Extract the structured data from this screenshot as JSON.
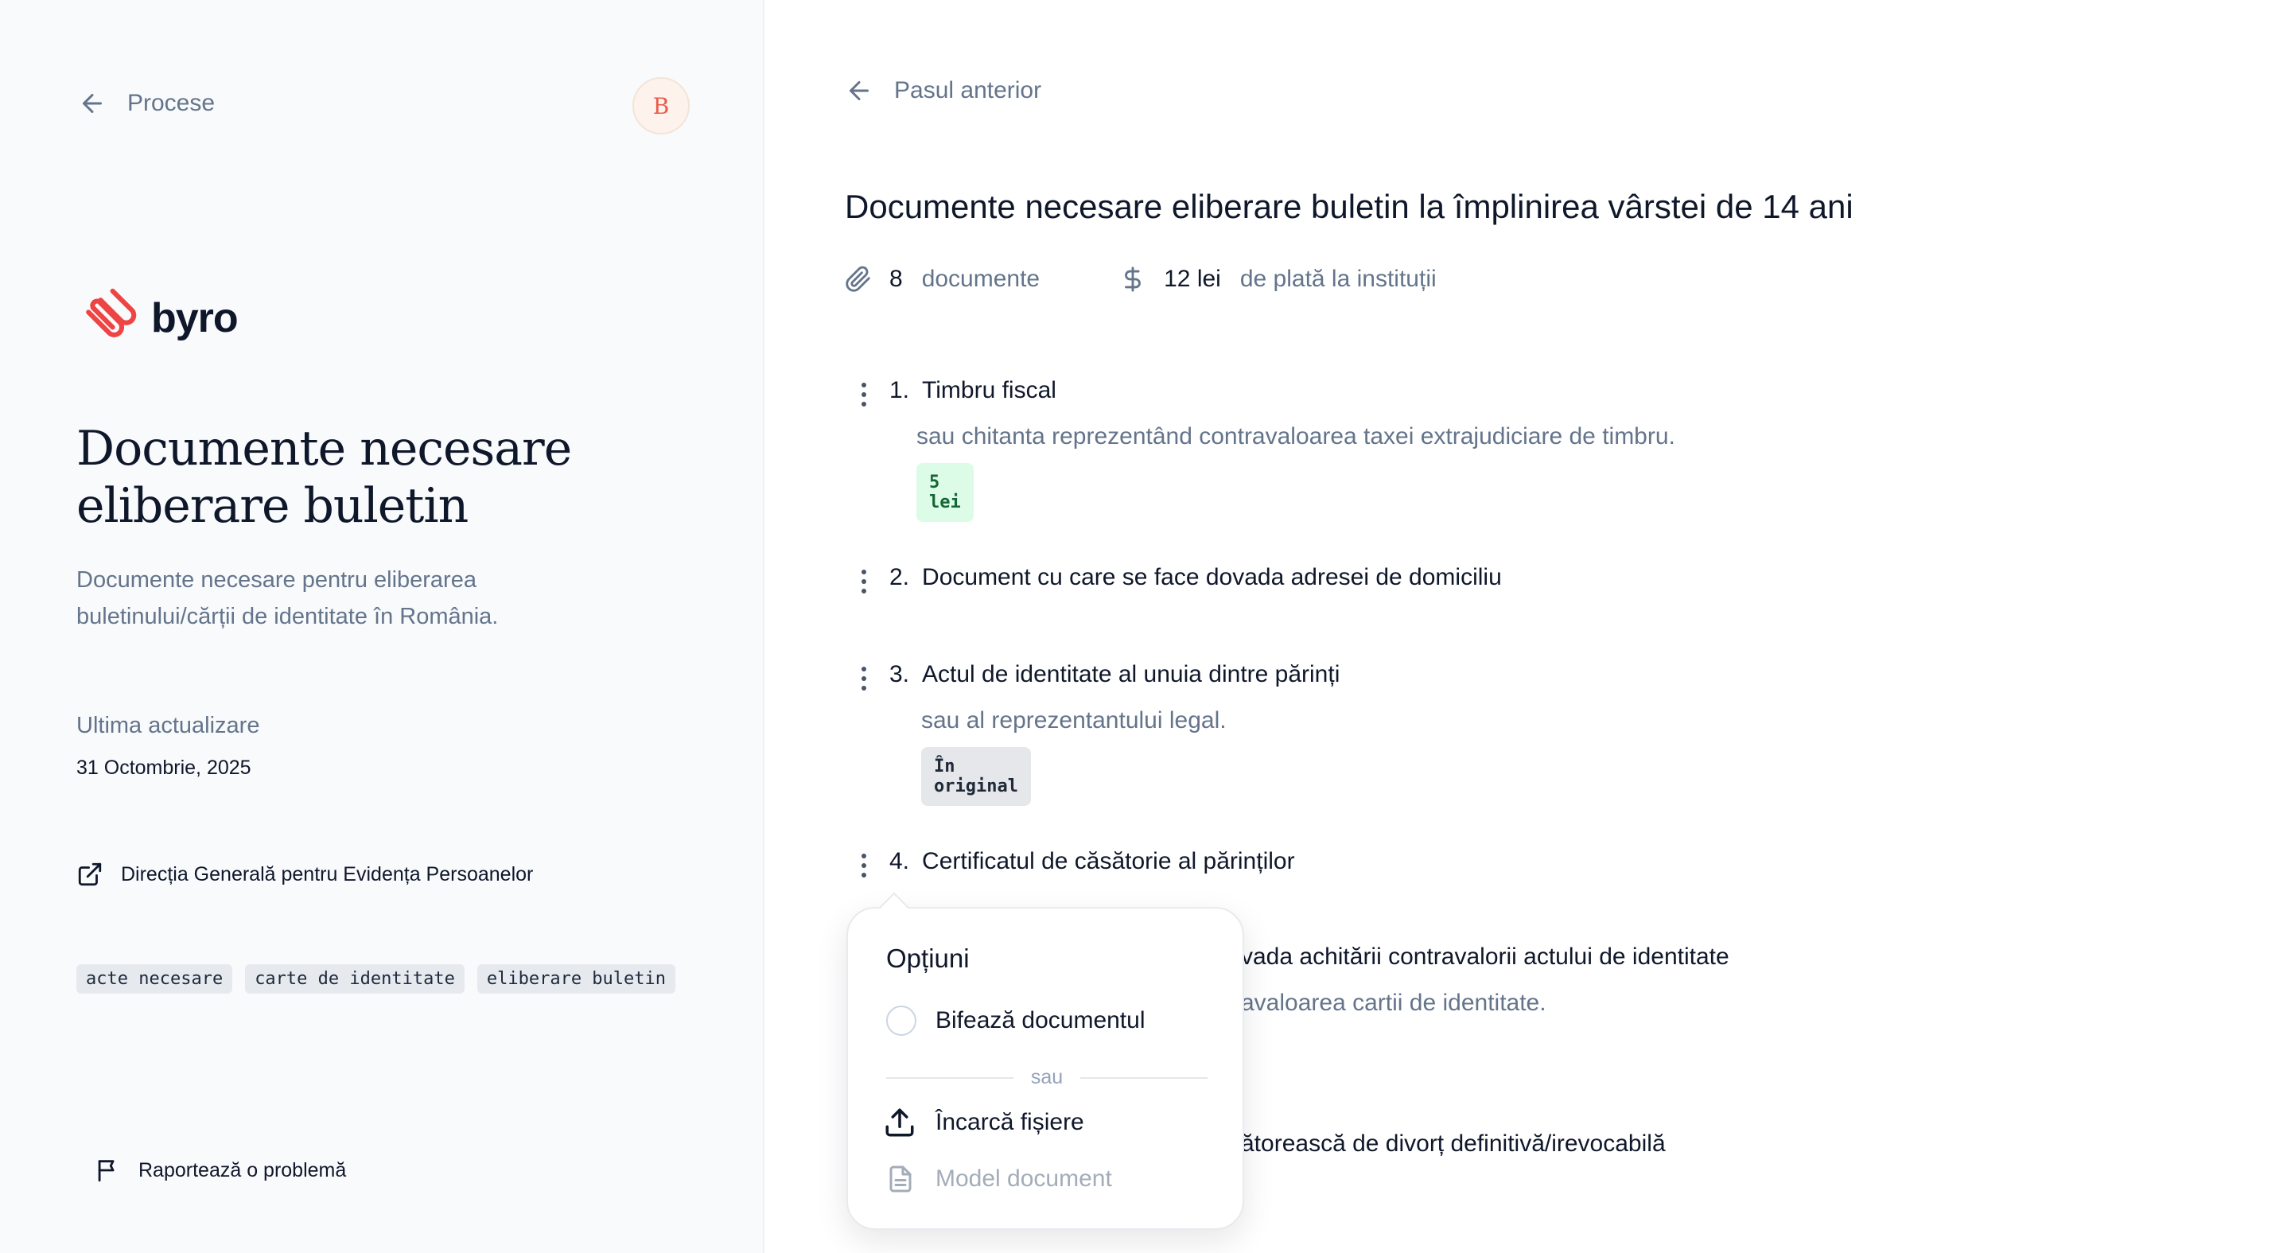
{
  "sidebar": {
    "back_label": "Procese",
    "avatar_initial": "B",
    "logo_text": "byro",
    "title": "Documente necesare eliberare buletin",
    "description": "Documente necesare pentru eliberarea buletinului/cărții de identitate în România.",
    "updated_label": "Ultima actualizare",
    "updated_date": "31 Octombrie, 2025",
    "institution_link": "Direcția Generală pentru Evidența Persoanelor",
    "tags": [
      "acte necesare",
      "carte de identitate",
      "eliberare buletin"
    ],
    "report_label": "Raportează o problemă"
  },
  "main": {
    "back_label": "Pasul anterior",
    "title": "Documente necesare eliberare buletin la împlinirea vârstei de 14 ani",
    "stats": {
      "documents_count": "8",
      "documents_label": "documente",
      "fee_amount": "12 lei",
      "fee_label": "de plată la instituții"
    },
    "documents": [
      {
        "number": "1.",
        "title": "Timbru fiscal",
        "subtitle": "sau chitanta reprezentând contravaloarea taxei extrajudiciare de timbru.",
        "badge": "5 lei"
      },
      {
        "number": "2.",
        "title": "Document cu care se face dovada adresei de domiciliu"
      },
      {
        "number": "3.",
        "title": "Actul de identitate al unuia dintre părinți",
        "subtitle": "sau al reprezentantului legal.",
        "badge": "În original"
      },
      {
        "number": "4.",
        "title": "Certificatul de căsătorie al părinților"
      },
      {
        "title_visible": "vada achitării contravalorii actului de identitate",
        "subtitle_visible": "avaloarea cartii de identitate."
      },
      {
        "title_visible": "ătorească de divorț definitivă/irevocabilă"
      }
    ]
  },
  "popover": {
    "title": "Opțiuni",
    "check_label": "Bifează documentul",
    "divider_label": "sau",
    "upload_label": "Încarcă fișiere",
    "model_label": "Model document"
  },
  "colors": {
    "accent": "#ef4444",
    "sidebar_bg": "#f8fafc",
    "muted_text": "#64748b",
    "badge_green_bg": "#dcfce7",
    "badge_gray_bg": "#e5e7eb"
  },
  "icons": [
    "arrow-left-icon",
    "paperclip-icon",
    "dollar-icon",
    "external-link-icon",
    "flag-icon",
    "upload-icon",
    "document-icon",
    "kebab-icon"
  ]
}
